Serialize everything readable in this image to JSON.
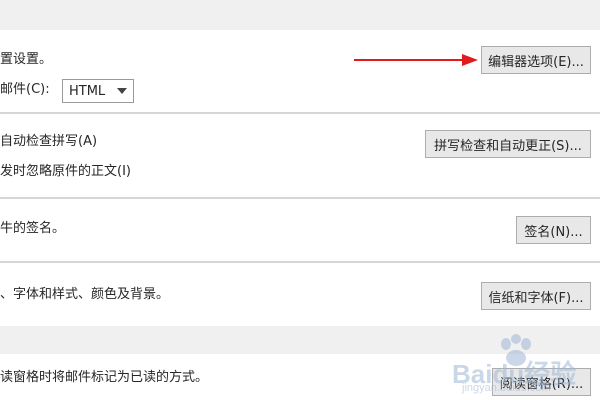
{
  "compose": {
    "editor_text": "置设置。",
    "editor_button": "编辑器选项(E)...",
    "format_label": "邮件(C):",
    "format_value": "HTML"
  },
  "spelling": {
    "auto_check": "自动检查拼写(A)",
    "ignore_original": "发时忽略原件的正文(I)",
    "button": "拼写检查和自动更正(S)..."
  },
  "signature": {
    "text": "牛的签名。",
    "button": "签名(N)..."
  },
  "stationery": {
    "text": "、字体和样式、颜色及背景。",
    "button": "信纸和字体(F)..."
  },
  "reading_pane": {
    "text": "读窗格时将邮件标记为已读的方式。",
    "button": "阅读窗格(R)..."
  },
  "watermark": {
    "text": "Baidu经验",
    "sub": "jingyan.baidu.com"
  },
  "colors": {
    "annotation_arrow": "#e11b1b",
    "band": "#f0f0f0",
    "separator": "#d6d6d6"
  }
}
